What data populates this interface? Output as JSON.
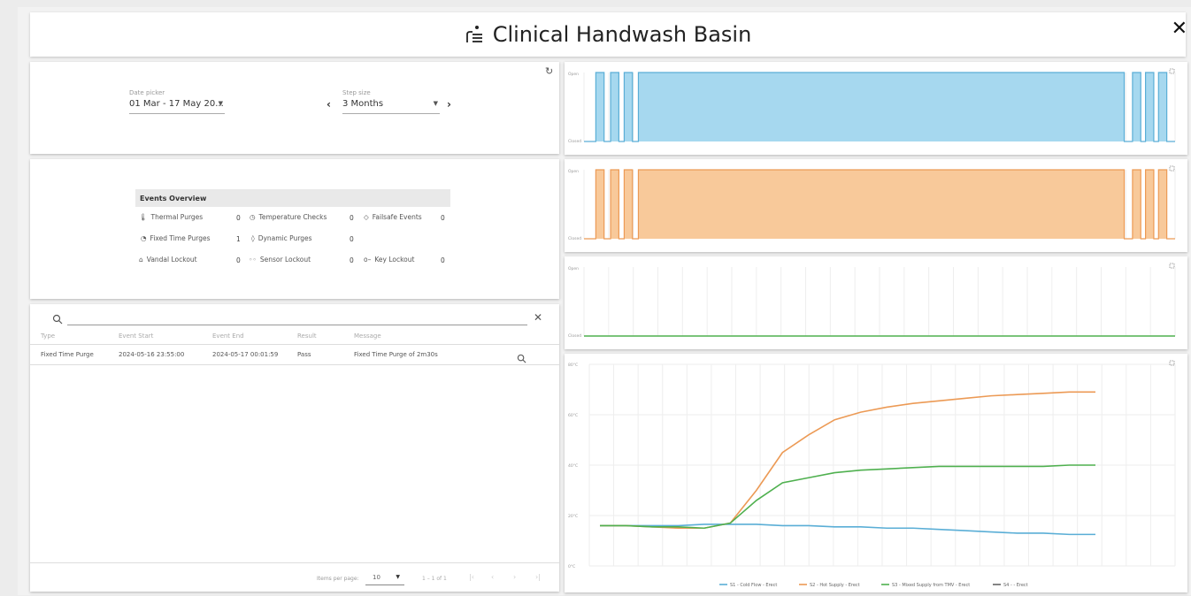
{
  "header": {
    "title": "Clinical Handwash Basin",
    "close_label": "✕"
  },
  "controls": {
    "date_picker_label": "Date picker",
    "date_picker_value": "01 Mar - 17 May 20...",
    "step_size_label": "Step size",
    "step_size_value": "3 Months",
    "prev_label": "‹",
    "next_label": "›",
    "refresh_icon": "↻"
  },
  "events_overview": {
    "title": "Events Overview",
    "items": [
      {
        "label": "Thermal Purges",
        "count": "0",
        "icon": "thermometer-icon"
      },
      {
        "label": "Temperature Checks",
        "count": "0",
        "icon": "clock-icon"
      },
      {
        "label": "Failsafe Events",
        "count": "0",
        "icon": "shield-icon"
      },
      {
        "label": "Fixed Time Purges",
        "count": "1",
        "icon": "timer-icon"
      },
      {
        "label": "Dynamic Purges",
        "count": "0",
        "icon": "drop-icon"
      },
      {
        "label": "Vandal Lockout",
        "count": "0",
        "icon": "lock-icon"
      },
      {
        "label": "Sensor Lockout",
        "count": "0",
        "icon": "sensor-icon"
      },
      {
        "label": "Key Lockout",
        "count": "0",
        "icon": "key-icon"
      }
    ]
  },
  "table": {
    "search_placeholder": "",
    "columns": [
      "Type",
      "Event Start",
      "Event End",
      "Result",
      "Message"
    ],
    "rows": [
      [
        "Fixed Time Purge",
        "2024-05-16 23:55:00",
        "2024-05-17 00:01:59",
        "Pass",
        "Fixed Time Purge of 2m30s"
      ]
    ],
    "items_per_page_label": "Items per page:",
    "items_per_page_value": "10",
    "range_label": "1 – 1 of 1"
  },
  "chart_data": [
    {
      "type": "line",
      "title": "",
      "ylabels": [
        "Open",
        "Closed"
      ],
      "color": "#a6d8ef",
      "stroke": "#5aaed6",
      "pattern": "pulses-then-open-then-pulses"
    },
    {
      "type": "line",
      "title": "",
      "ylabels": [
        "Open",
        "Closed"
      ],
      "color": "#f8c99a",
      "stroke": "#ec9a55",
      "pattern": "pulses-then-open-then-pulses"
    },
    {
      "type": "line",
      "title": "",
      "ylabels": [
        "Open",
        "Closed"
      ],
      "color": "#ffffff",
      "stroke": "#4fb04f",
      "pattern": "closed"
    },
    {
      "type": "line",
      "ylim": [
        0,
        80
      ],
      "yticks": [
        "0°C",
        "20°C",
        "40°C",
        "60°C",
        "80°C"
      ],
      "x": [
        0,
        1,
        2,
        3,
        4,
        5,
        6,
        7,
        8,
        9,
        10,
        11,
        12,
        13,
        14,
        15,
        16,
        17,
        18,
        19
      ],
      "series": [
        {
          "name": "S1 - Cold Flow - Erect",
          "color": "#5aaed6",
          "values": [
            16,
            16,
            16,
            16,
            16.5,
            16.5,
            16.5,
            16,
            16,
            15.5,
            15.5,
            15,
            15,
            14.5,
            14,
            13.5,
            13,
            13,
            12.5,
            12.5
          ]
        },
        {
          "name": "S2 - Hot Supply - Erect",
          "color": "#ec9a55",
          "values": [
            16,
            16,
            15.5,
            15,
            15,
            17,
            30,
            45,
            52,
            58,
            61,
            63,
            64.5,
            65.5,
            66.5,
            67.5,
            68,
            68.5,
            69,
            69
          ]
        },
        {
          "name": "S3 - Mixed Supply from TMV - Erect",
          "color": "#4fb04f",
          "values": [
            16,
            16,
            15.5,
            15.5,
            15,
            17,
            26,
            33,
            35,
            37,
            38,
            38.5,
            39,
            39.5,
            39.5,
            39.5,
            39.5,
            39.5,
            40,
            40
          ]
        },
        {
          "name": "S4 - - Erect",
          "color": "#666666",
          "values": []
        }
      ]
    }
  ]
}
